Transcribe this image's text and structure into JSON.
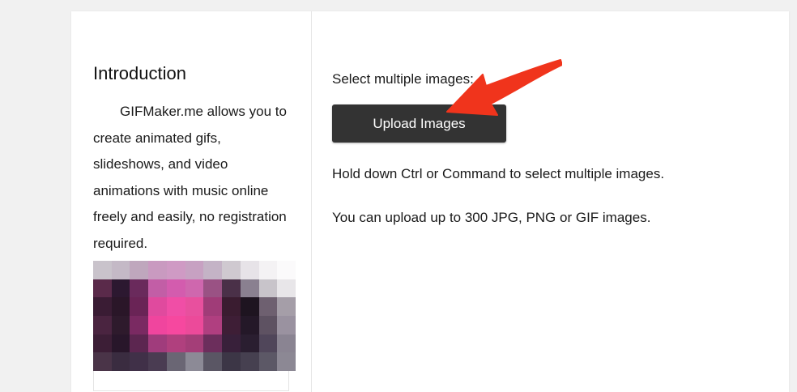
{
  "sidebar": {
    "title": "Introduction",
    "description": "GIFMaker.me allows you to create animated gifs, slideshows, and video animations with music online freely and easily, no registration required."
  },
  "main": {
    "select_label": "Select multiple images:",
    "upload_button_label": "Upload Images",
    "hint_ctrl": "Hold down Ctrl or Command to select multiple images.",
    "hint_limit": "You can upload up to 300 JPG, PNG or GIF images."
  },
  "colors": {
    "button_bg": "#333333",
    "annotation_arrow": "#f0341c"
  }
}
